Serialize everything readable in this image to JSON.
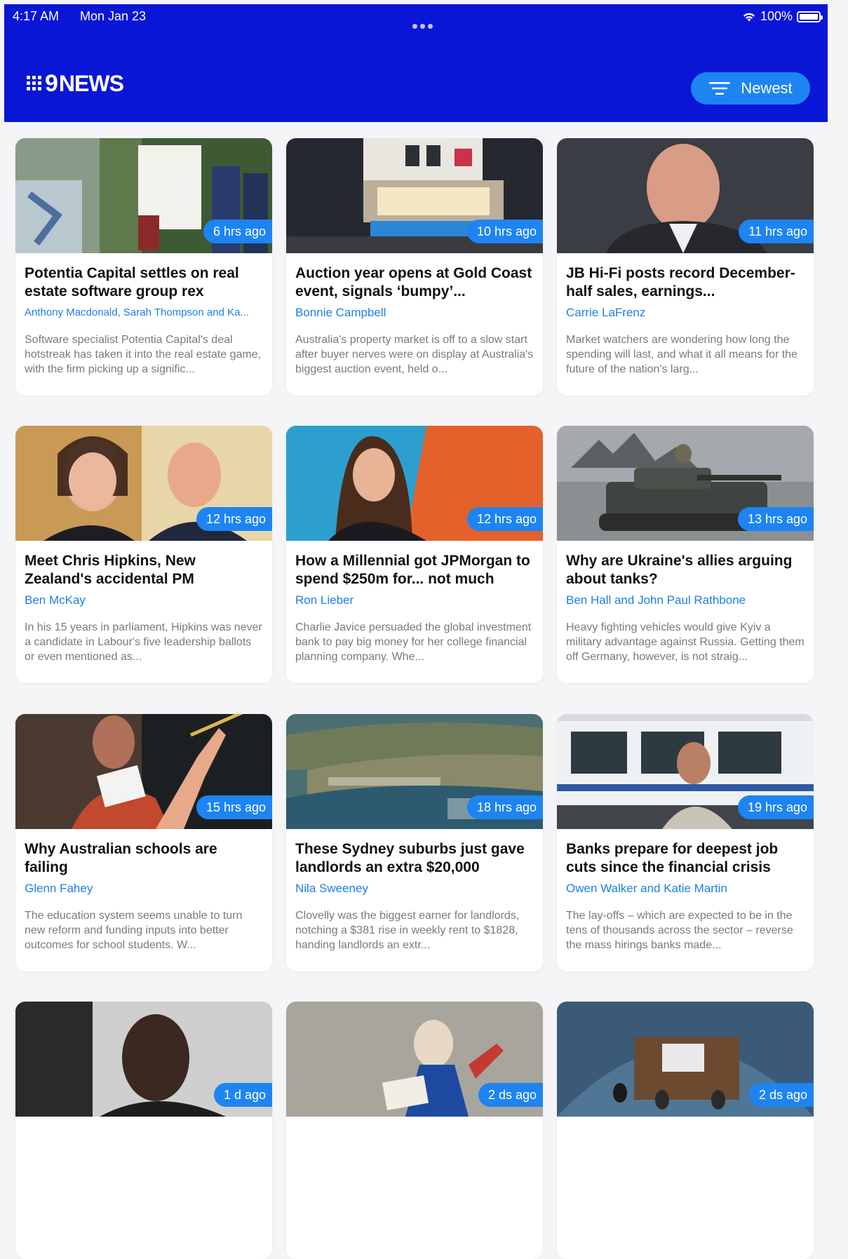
{
  "status_bar": {
    "time": "4:17 AM",
    "date": "Mon Jan 23",
    "battery": "100%"
  },
  "header": {
    "logo_text": "NEWS",
    "logo_number": "9",
    "sort_label": "Newest"
  },
  "colors": {
    "header_bg": "#0a16d6",
    "accent": "#1d84f2",
    "author": "#1d7fe6",
    "page_bg": "#f5f5f7"
  },
  "articles": [
    {
      "time": "6 hrs ago",
      "title": "Potentia Capital settles on real estate software group rex",
      "author": "Anthony Macdonald, Sarah Thompson and Ka...",
      "summary": "Software specialist Potentia Capital's deal hotstreak has taken it into the real estate game, with the firm picking up a signific..."
    },
    {
      "time": "10 hrs ago",
      "title": "Auction year opens at Gold Coast event, signals ‘bumpy’...",
      "author": "Bonnie Campbell",
      "summary": "Australia's property market is off to a slow start after buyer nerves were on display at Australia's biggest auction event, held o..."
    },
    {
      "time": "11 hrs ago",
      "title": "JB Hi-Fi posts record December-half sales, earnings...",
      "author": "Carrie LaFrenz",
      "summary": "Market watchers are wondering how long the spending will last, and what it all means for the future of the nation's larg..."
    },
    {
      "time": "12 hrs ago",
      "title": "Meet Chris Hipkins, New Zealand's accidental PM",
      "author": "Ben McKay",
      "summary": "In his 15 years in parliament, Hipkins was never a candidate in Labour's five leadership ballots or even mentioned as..."
    },
    {
      "time": "12 hrs ago",
      "title": "How a Millennial got JPMorgan to spend $250m for... not much",
      "author": "Ron Lieber",
      "summary": "Charlie Javice persuaded the global investment bank to pay big money for her college financial planning company. Whe..."
    },
    {
      "time": "13 hrs ago",
      "title": "Why are Ukraine's allies arguing about tanks?",
      "author": "Ben Hall and John Paul Rathbone",
      "summary": "Heavy fighting vehicles would give Kyiv a military advantage against Russia. Getting them off Germany, however, is not straig..."
    },
    {
      "time": "15 hrs ago",
      "title": "Why Australian schools are failing",
      "author": "Glenn Fahey",
      "summary": "The education system seems unable to turn new reform and funding inputs into better outcomes for school students. W..."
    },
    {
      "time": "18 hrs ago",
      "title": "These Sydney suburbs just gave landlords an extra $20,000",
      "author": "Nila Sweeney",
      "summary": "Clovelly was the biggest earner for landlords, notching a $381 rise in weekly rent to $1828, handing landlords an extr..."
    },
    {
      "time": "19 hrs ago",
      "title": "Banks prepare for deepest job cuts since the financial crisis",
      "author": "Owen Walker and Katie Martin",
      "summary": "The lay-offs – which are expected to be in the tens of thousands across the sector – reverse the mass hirings banks made..."
    },
    {
      "time": "1 d ago",
      "title": "",
      "author": "",
      "summary": ""
    },
    {
      "time": "2 ds ago",
      "title": "",
      "author": "",
      "summary": ""
    },
    {
      "time": "2 ds ago",
      "title": "",
      "author": "",
      "summary": ""
    }
  ]
}
